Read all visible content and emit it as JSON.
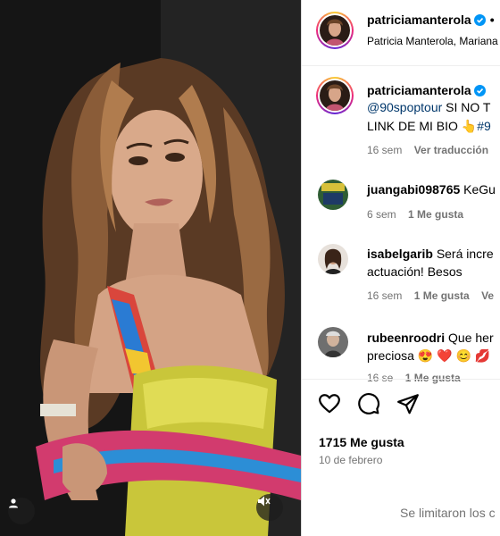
{
  "post": {
    "author": "patriciamanterola",
    "tagged": "Patricia Manterola, Mariana",
    "caption": {
      "mention": "@90spoptour",
      "line1": " SI NO T",
      "line2_text": "LINK DE MI BIO ",
      "line2_emoji": "👆",
      "line2_hashtag": "#9",
      "time": "16 sem",
      "translate": "Ver traducción"
    },
    "likes": "1715 Me gusta",
    "date": "10 de febrero",
    "comments_limited": "Se limitaron los c"
  },
  "comments": [
    {
      "user": "juangabi098765",
      "text": "KeGu",
      "time": "6 sem",
      "likes": "1 Me gusta"
    },
    {
      "user": "isabelgarib",
      "text": "Será incre",
      "text2": "actuación! Besos",
      "time": "16 sem",
      "likes": "1 Me gusta",
      "reply": "Ve"
    },
    {
      "user": "rubeenroodri",
      "text": "Que her",
      "text2": "preciosa 😍 ❤️ 😊 💋",
      "time": "16 se",
      "likes": "1 Me gusta"
    }
  ],
  "icons": {
    "like": "heart-icon",
    "comment": "comment-icon",
    "share": "share-icon",
    "tag": "user-tag-icon",
    "mute": "muted-speaker-icon",
    "verified": "verified-badge-icon"
  },
  "colors": {
    "link": "#00376b",
    "verified": "#0095f6",
    "muted_text": "#737373"
  }
}
